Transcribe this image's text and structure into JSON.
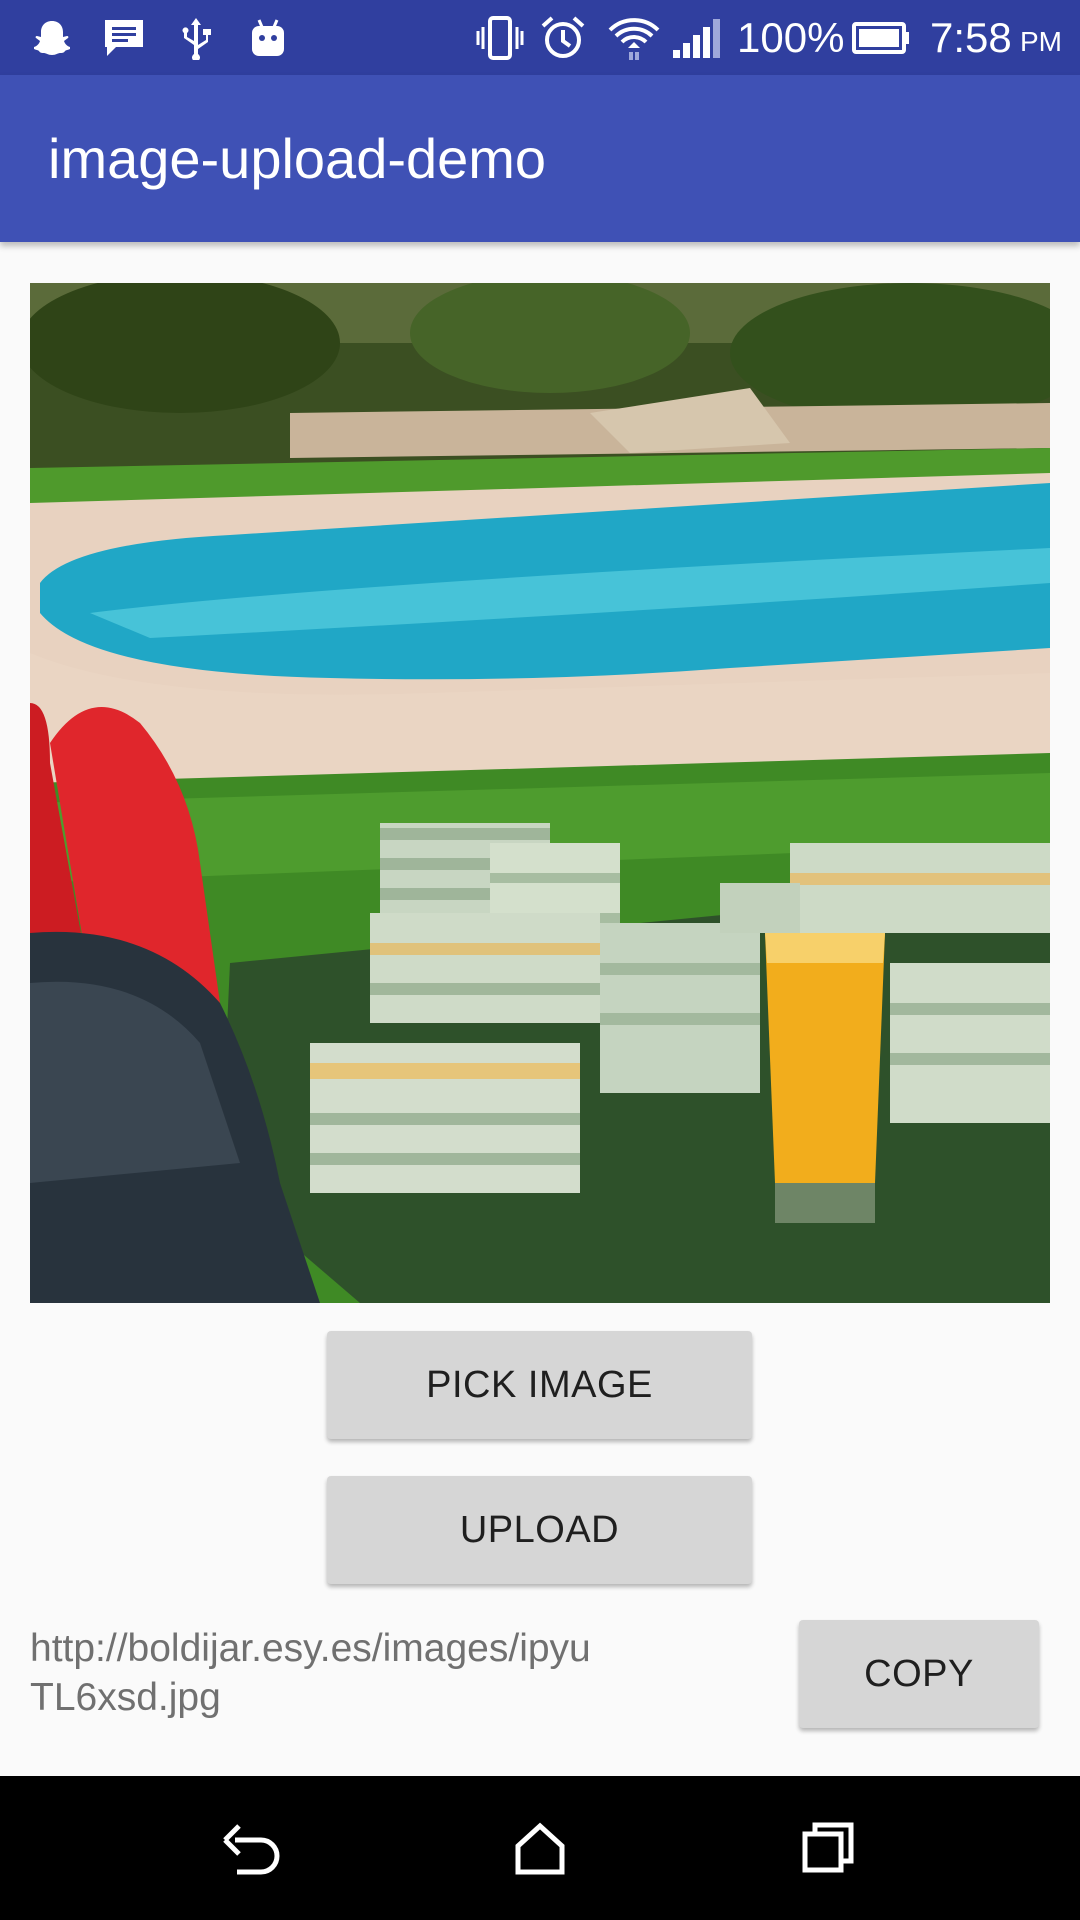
{
  "status_bar": {
    "battery": "100%",
    "time": "7:58",
    "meridiem": "PM",
    "icons": [
      "snapchat-icon",
      "message-icon",
      "usb-icon",
      "android-icon",
      "vibrate-icon",
      "alarm-icon",
      "wifi-icon",
      "signal-icon",
      "battery-icon"
    ]
  },
  "app_bar": {
    "title": "image-upload-demo"
  },
  "image_preview": {
    "content": "poolside photo"
  },
  "buttons": {
    "pick_label": "PICK IMAGE",
    "upload_label": "UPLOAD",
    "copy_label": "COPY"
  },
  "result": {
    "url": "http://boldijar.esy.es/images/ipyuTL6xsd.jpg"
  },
  "nav_bar": {
    "icons": [
      "back-icon",
      "home-icon",
      "recents-icon"
    ]
  },
  "colors": {
    "status_bar": "#303f9f",
    "app_bar": "#3f51b5",
    "button": "#d6d6d6",
    "background": "#fafafa"
  }
}
